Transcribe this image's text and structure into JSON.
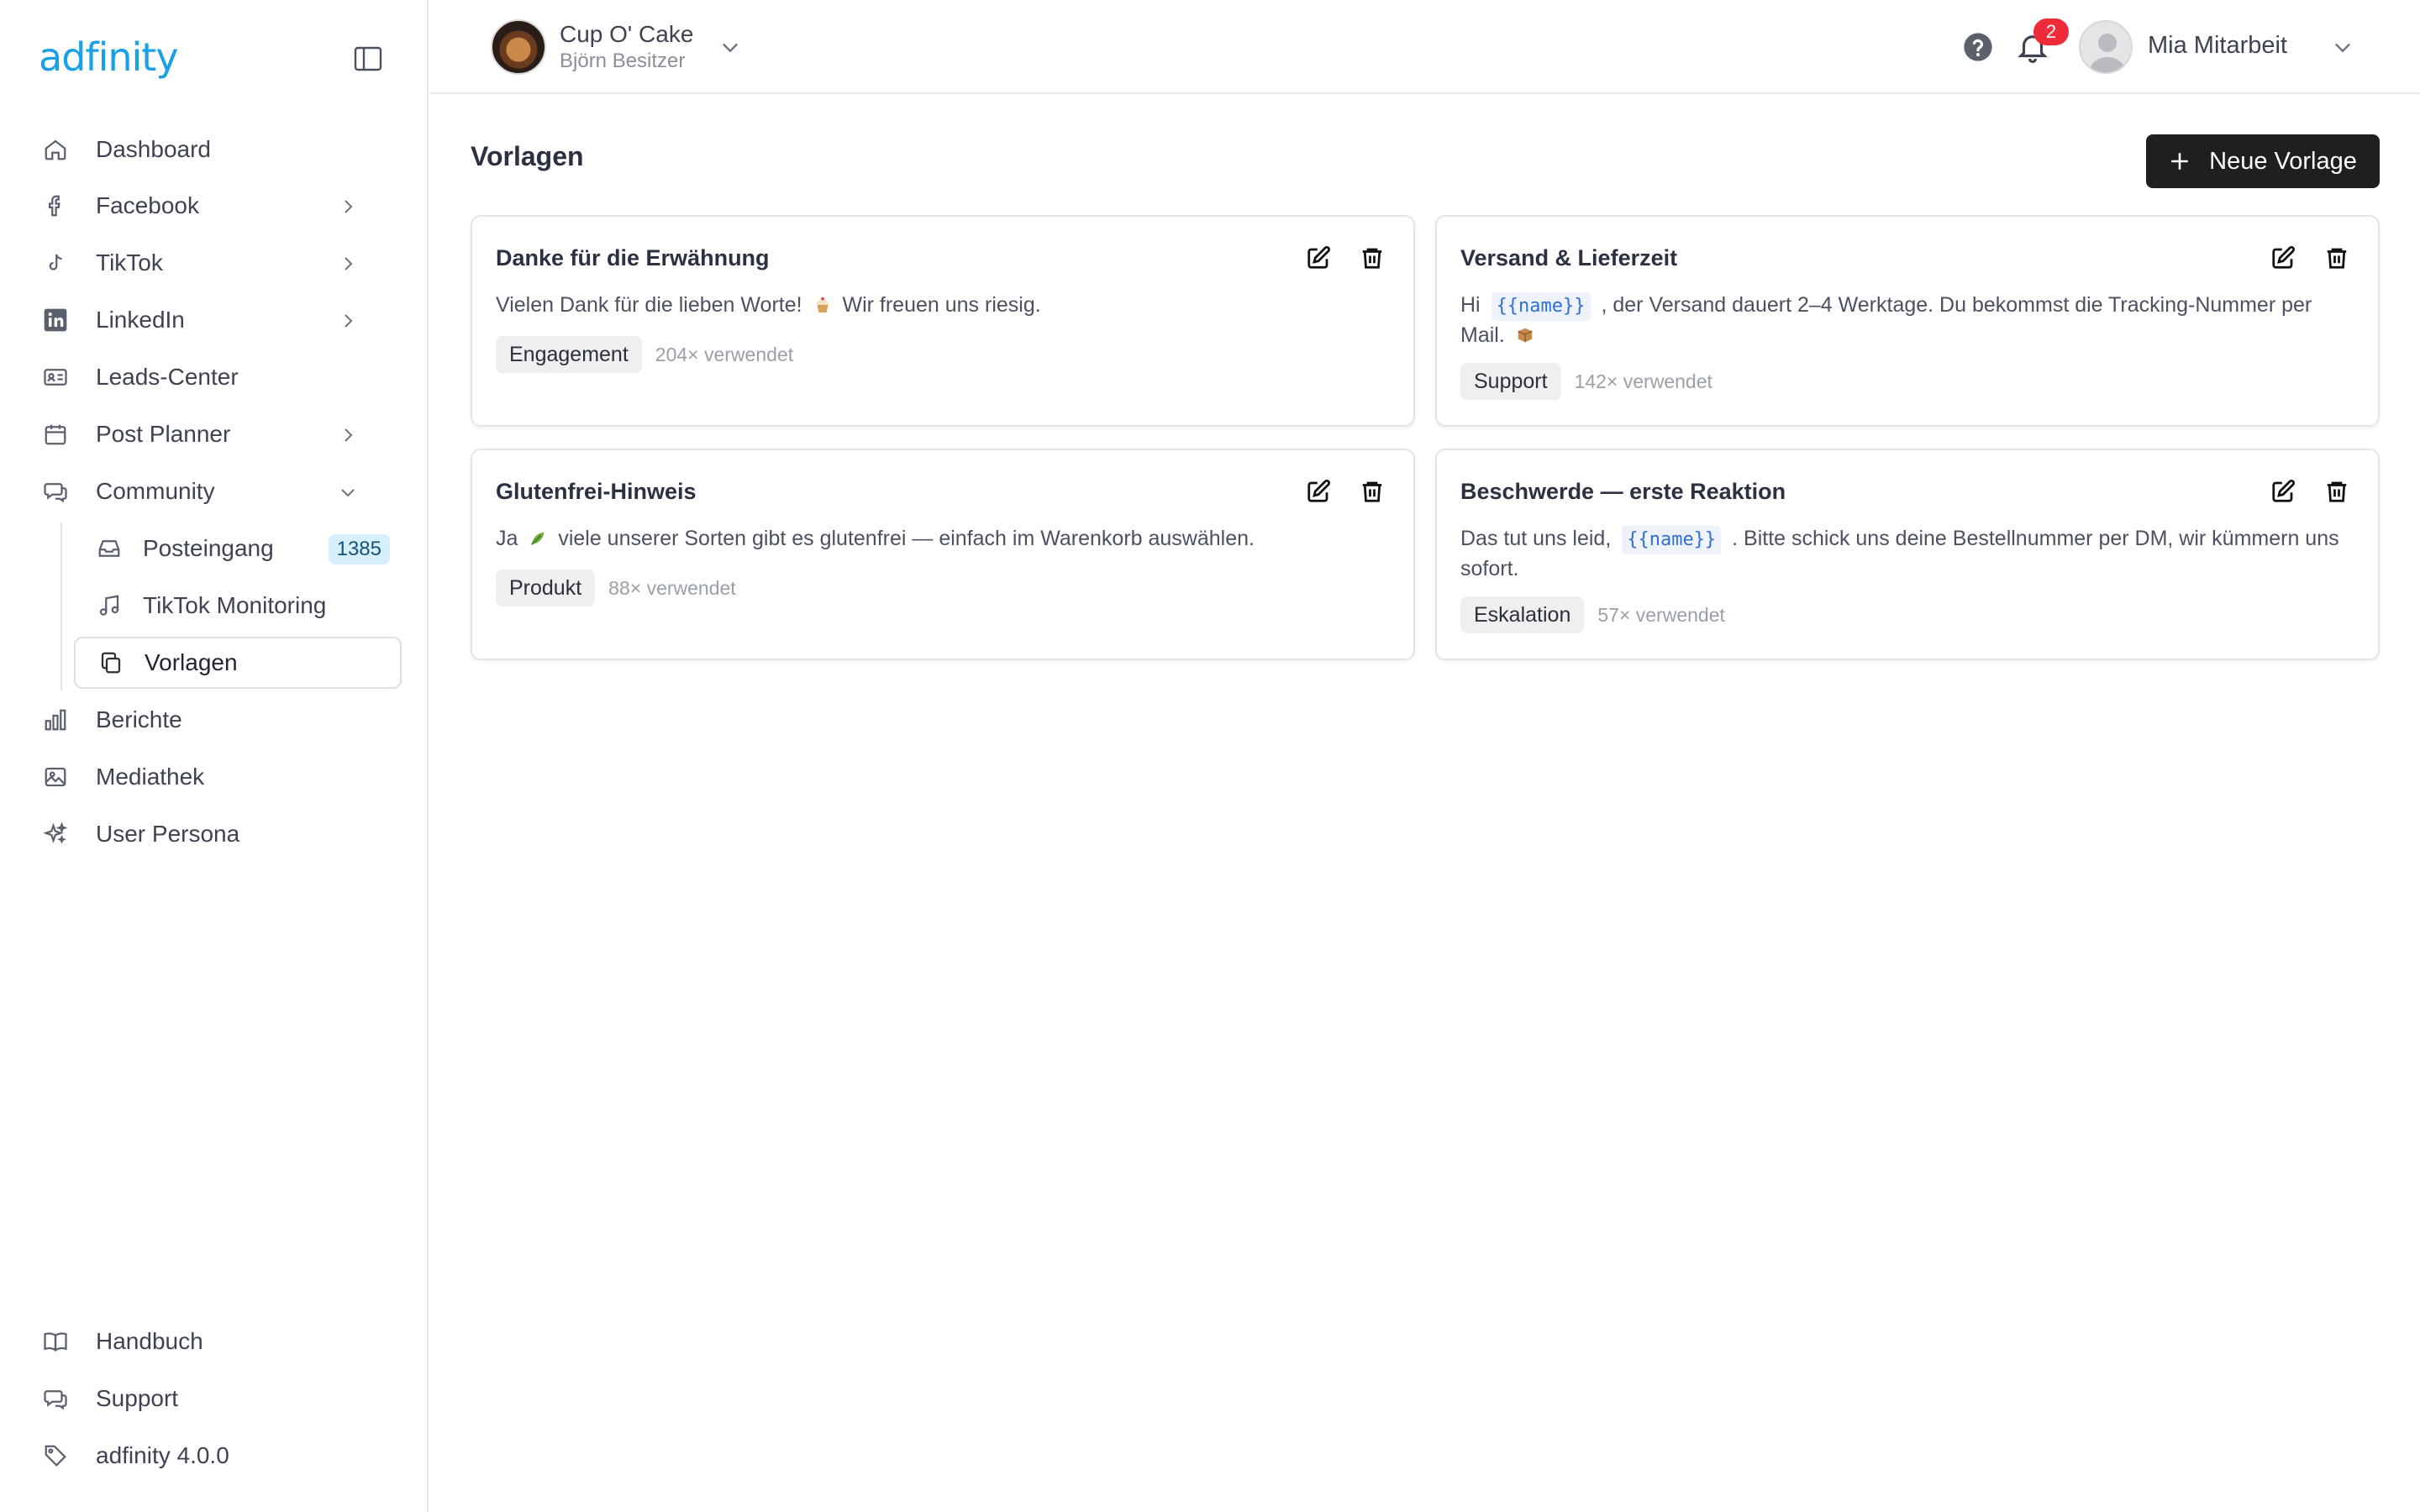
{
  "app": {
    "logo_text": "adfinity"
  },
  "sidebar": {
    "items": [
      {
        "label": "Dashboard",
        "icon": "home-icon"
      },
      {
        "label": "Facebook",
        "icon": "facebook-icon"
      },
      {
        "label": "TikTok",
        "icon": "tiktok-icon"
      },
      {
        "label": "LinkedIn",
        "icon": "linkedin-icon"
      },
      {
        "label": "Leads-Center",
        "icon": "contact-card-icon"
      },
      {
        "label": "Post Planner",
        "icon": "calendar-icon"
      },
      {
        "label": "Community",
        "icon": "chat-icon"
      },
      {
        "label": "Berichte",
        "icon": "bar-chart-icon"
      },
      {
        "label": "Mediathek",
        "icon": "image-icon"
      },
      {
        "label": "User Persona",
        "icon": "sparkles-icon"
      }
    ],
    "community_sub": [
      {
        "label": "Posteingang",
        "badge": "1385",
        "icon": "inbox-icon"
      },
      {
        "label": "TikTok Monitoring",
        "icon": "music-note-icon"
      },
      {
        "label": "Vorlagen",
        "icon": "copy-icon"
      }
    ],
    "footer": [
      {
        "label": "Handbuch",
        "icon": "book-icon"
      },
      {
        "label": "Support",
        "icon": "chat-icon"
      },
      {
        "label": "adfinity 4.0.0",
        "icon": "tag-icon"
      }
    ]
  },
  "topbar": {
    "account_name": "Cup O' Cake",
    "account_owner": "Björn Besitzer",
    "notifications_count": "2",
    "user_name": "Mia Mitarbeit"
  },
  "main": {
    "title": "Vorlagen",
    "new_button": "Neue Vorlage",
    "templates": [
      {
        "title": "Danke für die Erwähnung",
        "text_before": "Vielen Dank für die lieben Worte!",
        "text_after": "Wir freuen uns riesig.",
        "tag": "Engagement",
        "uses": "204× verwendet"
      },
      {
        "title": "Versand & Lieferzeit",
        "text_before": "Hi",
        "variable": "{{name}}",
        "text_after": ", der Versand dauert 2–4 Werktage. Du bekommst die Tracking-Nummer per Mail.",
        "tag": "Support",
        "uses": "142× verwendet"
      },
      {
        "title": "Glutenfrei-Hinweis",
        "text_before": "Ja",
        "text_after": "viele unserer Sorten gibt es glutenfrei — einfach im Warenkorb auswählen.",
        "tag": "Produkt",
        "uses": "88× verwendet"
      },
      {
        "title": "Beschwerde — erste Reaktion",
        "text_before": "Das tut uns leid,",
        "variable": "{{name}}",
        "text_after": ". Bitte schick uns deine Bestellnummer per DM, wir kümmern uns sofort.",
        "tag": "Eskalation",
        "uses": "57× verwendet"
      }
    ]
  }
}
